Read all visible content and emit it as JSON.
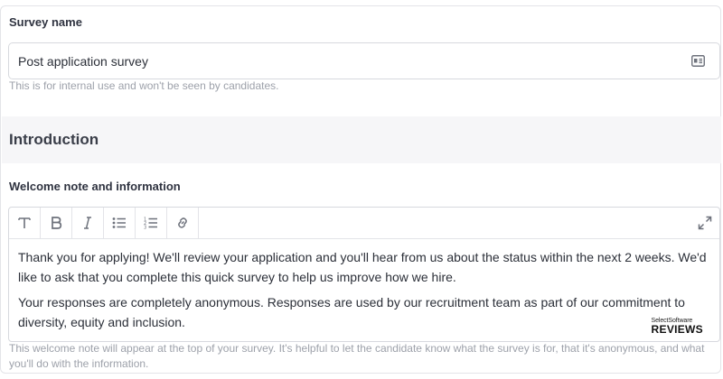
{
  "survey_name": {
    "label": "Survey name",
    "value": "Post application survey",
    "help": "This is for internal use and won't be seen by candidates."
  },
  "introduction": {
    "title": "Introduction"
  },
  "welcome_note": {
    "label": "Welcome note and information",
    "toolbar": {
      "icons": [
        "text-style-icon",
        "bold-icon",
        "italic-icon",
        "bullet-list-icon",
        "numbered-list-icon",
        "link-icon",
        "expand-icon"
      ]
    },
    "paragraphs": [
      "Thank you for applying! We'll review your application and you'll hear from us about the status within the next 2 weeks. We'd like to ask that you complete this quick survey to help us improve how we hire.",
      "Your responses are completely anonymous. Responses are used by our recruitment team as part of our commitment to diversity, equity and inclusion."
    ],
    "help": "This welcome note will appear at the top of your survey. It's helpful to let the candidate know what the survey is for, that it's anonymous, and what you'll do with the information."
  },
  "watermark": {
    "top": "SelectSoftware",
    "bottom": "REVIEWS"
  }
}
